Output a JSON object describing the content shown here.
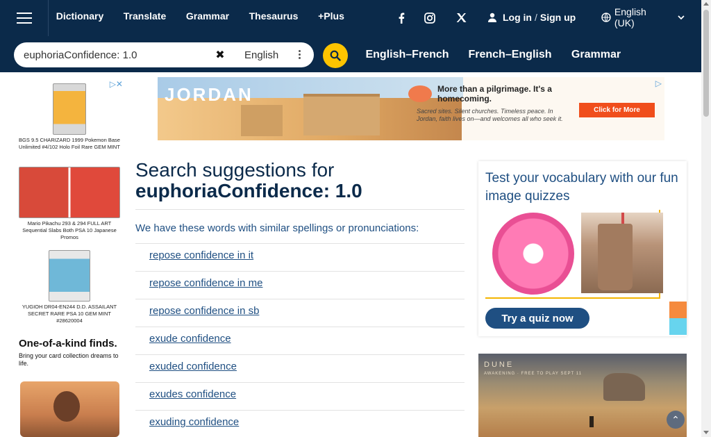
{
  "nav": {
    "links": [
      {
        "label": "Dictionary"
      },
      {
        "label": "Translate"
      },
      {
        "label": "Grammar"
      },
      {
        "label": "Thesaurus"
      },
      {
        "label": "+Plus"
      }
    ],
    "social": [
      "facebook-icon",
      "instagram-icon",
      "x-icon"
    ],
    "login_label": "Log in",
    "separator": "/",
    "signup_label": "Sign up",
    "language": "English (UK)"
  },
  "search": {
    "value": "euphoriaConfidence: 1.0",
    "dictionary": "English",
    "quick_links": [
      "English–French",
      "French–English",
      "Grammar"
    ]
  },
  "left_ad": {
    "cards": [
      {
        "caption": "BGS 9.5 CHARIZARD 1999 Pokemon Base Unlimited #4/102 Holo Foil Rare GEM MINT"
      },
      {
        "caption": "Mario Pikachu 293 & 294 FULL ART Sequential Slabs Both PSA 10 Japanese Promos"
      },
      {
        "caption": "YUGIOH DR04-EN244 D.D. ASSAILANT SECRET RARE PSA 10 GEM MINT #28620004"
      }
    ],
    "headline": "One-of-a-kind finds.",
    "subline": "Bring your card collection dreams to life."
  },
  "banner_ad": {
    "brand": "JORDAN",
    "tagline": "More than a pilgrimage. It's a homecoming.",
    "body": "Sacred sites. Silent churches. Timeless peace. In Jordan, faith lives on—and welcomes all who seek it.",
    "cta": "Click for More"
  },
  "main": {
    "heading_prefix": "Search suggestions for",
    "heading_term": "euphoriaConfidence: 1.0",
    "similar_text": "We have these words with similar spellings or pronunciations:",
    "suggestions": [
      "repose confidence in it",
      "repose confidence in me",
      "repose confidence in sb",
      "exude confidence",
      "exuded confidence",
      "exudes confidence",
      "exuding confidence"
    ]
  },
  "quiz": {
    "title": "Test your vocabulary with our fun image quizzes",
    "button": "Try a quiz now"
  },
  "dune_ad": {
    "logo": "DUNE",
    "sub": "AWAKENING · FREE TO PLAY SEPT 11"
  },
  "colors": {
    "nav_bg": "#0b2a4a",
    "accent_yellow": "#fec400",
    "link_blue": "#1f4f82"
  }
}
